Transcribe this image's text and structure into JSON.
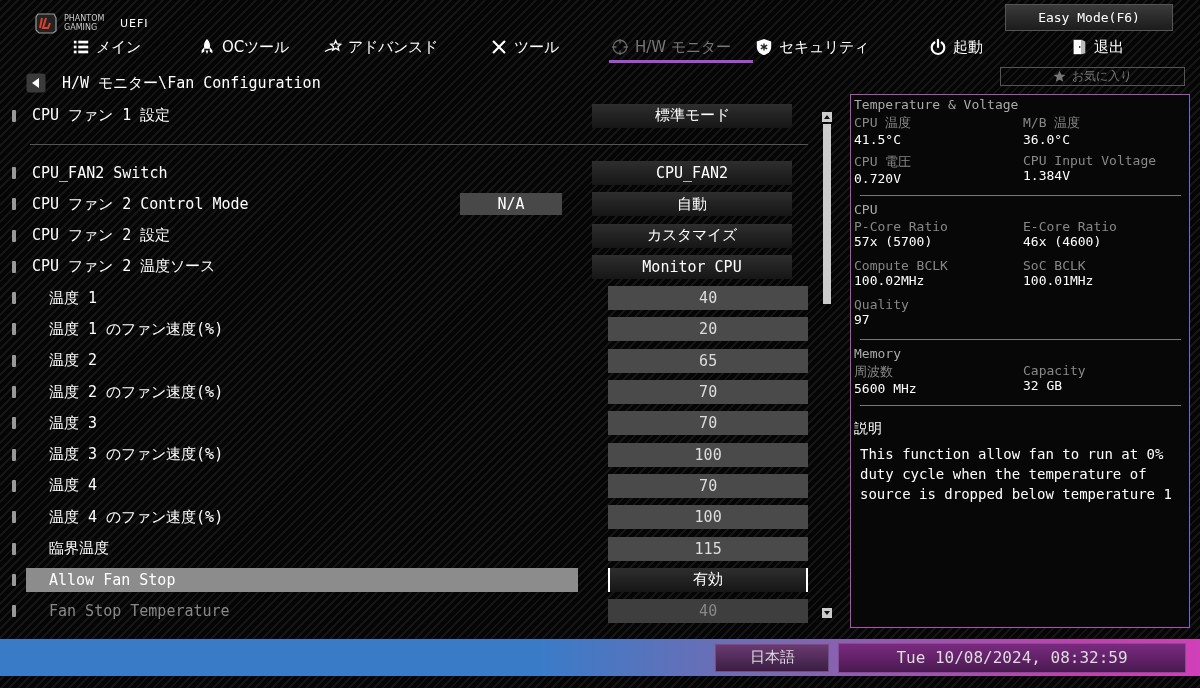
{
  "header": {
    "brand": "PHANTOM GAMING",
    "brand_sub": "UEFI",
    "easy_mode_button": "Easy Mode(F6)"
  },
  "tabs": [
    {
      "label": "メイン",
      "selected": false
    },
    {
      "label": "OCツール",
      "selected": false
    },
    {
      "label": "アドバンスド",
      "selected": false
    },
    {
      "label": "ツール",
      "selected": false
    },
    {
      "label": "H/W モニター",
      "selected": true
    },
    {
      "label": "セキュリティ",
      "selected": false
    },
    {
      "label": "起動",
      "selected": false
    },
    {
      "label": "退出",
      "selected": false
    }
  ],
  "breadcrumb": "H/W モニター\\Fan Configuration",
  "favorites": "お気に入り",
  "settings": [
    {
      "rows": [
        {
          "label": "CPU ファン 1 設定",
          "value": "標準モード",
          "kind": "option",
          "selected": false,
          "disabled": false
        }
      ]
    },
    {
      "rows": [
        {
          "label": "CPU_FAN2 Switch",
          "value": "CPU_FAN2",
          "kind": "option",
          "selected": false,
          "disabled": false
        },
        {
          "label": "CPU ファン 2 Control Mode",
          "status": "N/A",
          "value": "自動",
          "kind": "option",
          "selected": false,
          "disabled": false
        },
        {
          "label": "CPU ファン 2 設定",
          "value": "カスタマイズ",
          "kind": "option",
          "selected": false,
          "disabled": false
        },
        {
          "label": "CPU ファン 2 温度ソース",
          "value": "Monitor CPU",
          "kind": "option",
          "selected": false,
          "disabled": false,
          "children": [
            {
              "label": "温度 1",
              "value": "40",
              "kind": "number",
              "selected": false,
              "disabled": false
            },
            {
              "label": "温度 1 のファン速度(%)",
              "value": "20",
              "kind": "number",
              "selected": false,
              "disabled": false
            },
            {
              "label": "温度 2",
              "value": "65",
              "kind": "number",
              "selected": false,
              "disabled": false
            },
            {
              "label": "温度 2 のファン速度(%)",
              "value": "70",
              "kind": "number",
              "selected": false,
              "disabled": false
            },
            {
              "label": "温度 3",
              "value": "70",
              "kind": "number",
              "selected": false,
              "disabled": false
            },
            {
              "label": "温度 3 のファン速度(%)",
              "value": "100",
              "kind": "number",
              "selected": false,
              "disabled": false
            },
            {
              "label": "温度 4",
              "value": "70",
              "kind": "number",
              "selected": false,
              "disabled": false
            },
            {
              "label": "温度 4 のファン速度(%)",
              "value": "100",
              "kind": "number",
              "selected": false,
              "disabled": false
            },
            {
              "label": "臨界温度",
              "value": "115",
              "kind": "number",
              "selected": false,
              "disabled": false
            },
            {
              "label": "Allow Fan Stop",
              "value": "有効",
              "kind": "option",
              "selected": true,
              "disabled": false
            },
            {
              "label": "Fan Stop Temperature",
              "value": "40",
              "kind": "number",
              "selected": false,
              "disabled": true
            }
          ]
        }
      ]
    }
  ],
  "info_panel": {
    "sections": [
      {
        "title": "Temperature & Voltage",
        "items": [
          {
            "label": "CPU 温度",
            "value": "41.5°C"
          },
          {
            "label": "M/B 温度",
            "value": "36.0°C"
          },
          {
            "label": "CPU 電圧",
            "value": "0.720V"
          },
          {
            "label": "CPU Input Voltage",
            "value": "1.384V"
          }
        ]
      },
      {
        "title": "CPU",
        "items": [
          {
            "label": "P-Core Ratio",
            "value": "57x (5700)"
          },
          {
            "label": "E-Core Ratio",
            "value": "46x (4600)"
          },
          {
            "label": "Compute BCLK",
            "value": "100.02MHz"
          },
          {
            "label": "SoC BCLK",
            "value": "100.01MHz"
          },
          {
            "label": "Quality",
            "value": "97"
          }
        ]
      },
      {
        "title": "Memory",
        "items": [
          {
            "label": "周波数",
            "value": "5600 MHz"
          },
          {
            "label": "Capacity",
            "value": "32 GB"
          }
        ]
      }
    ],
    "description": {
      "title": "説明",
      "text": "This function allow fan to run at 0% duty cycle when the temperature of source is dropped below temperature 1"
    }
  },
  "status_bar": {
    "language": "日本語",
    "datetime": "Tue 10/08/2024, 08:32:59"
  }
}
